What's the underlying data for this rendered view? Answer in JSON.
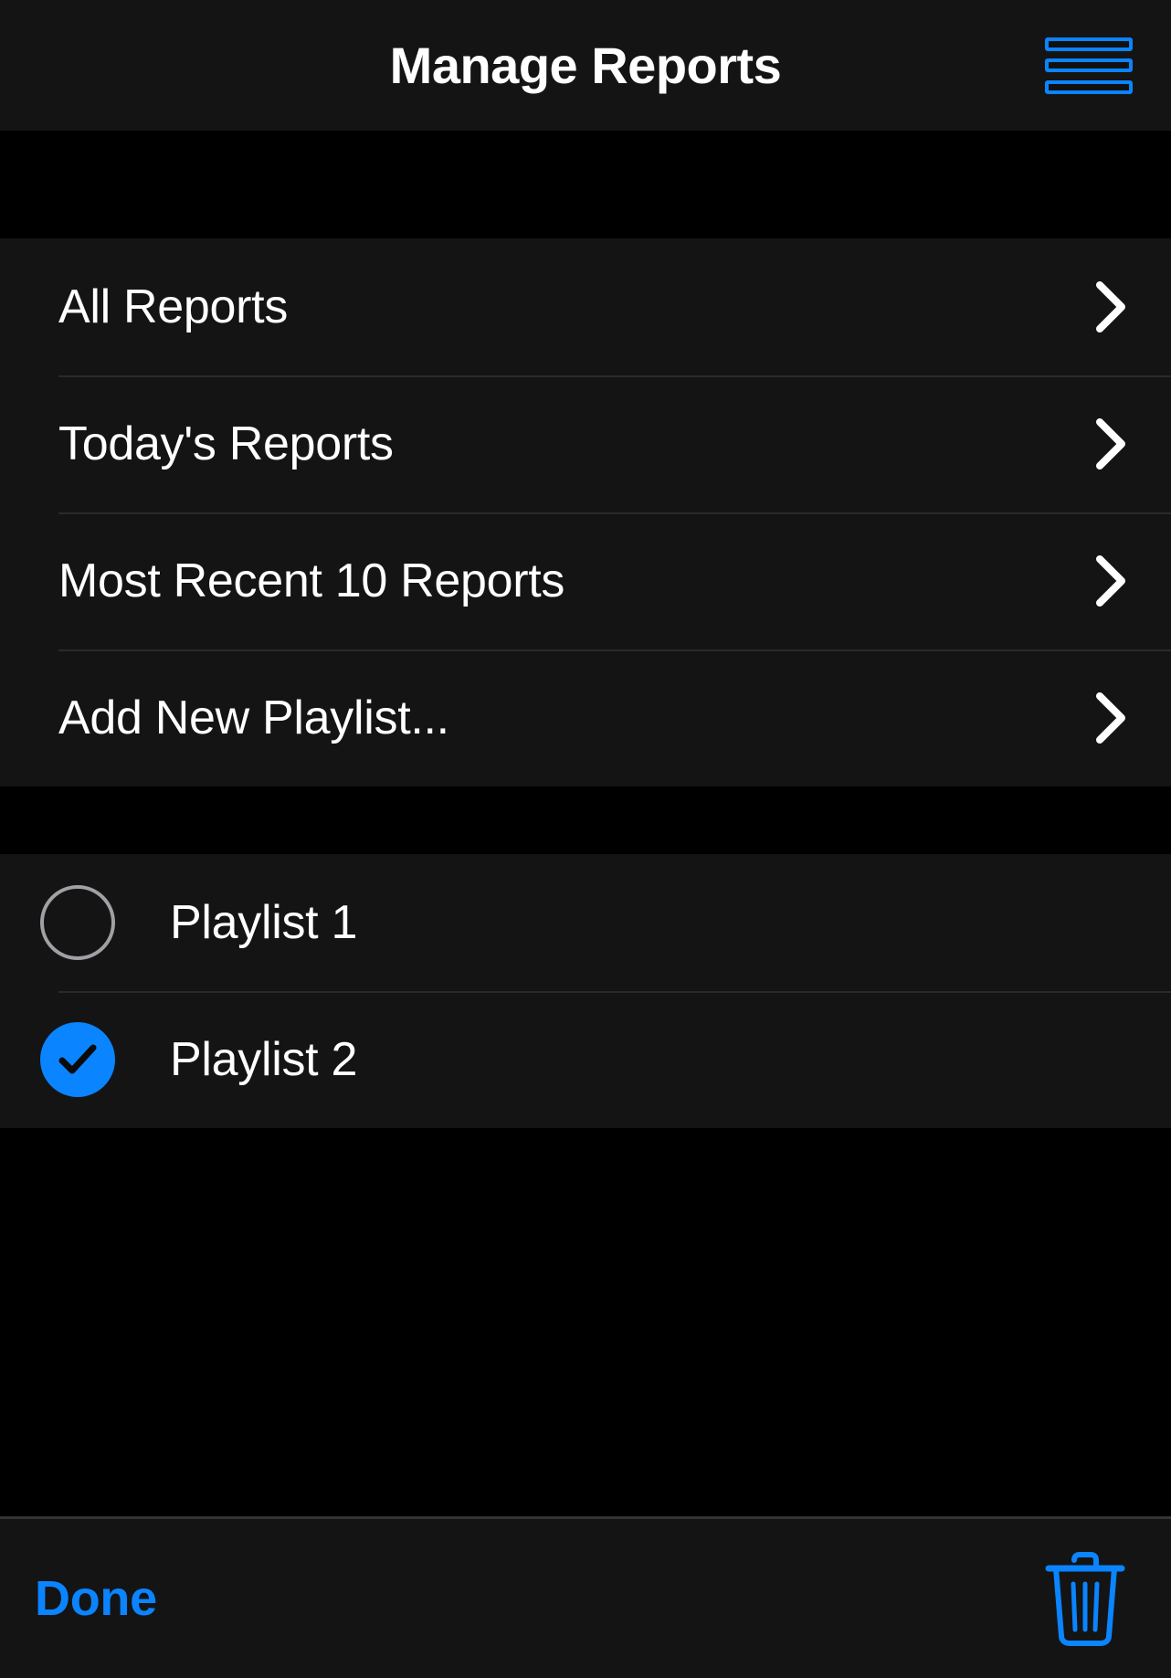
{
  "app": {
    "background_color": "#000000",
    "surface_color": "#141414",
    "accent_color": "#0a84ff",
    "separator_color": "#2a2a2c",
    "text_color": "#ffffff"
  },
  "navbar": {
    "title": "Manage Reports",
    "menu_icon": "hamburger-menu-icon"
  },
  "reports_section": {
    "rows": [
      {
        "label": "All Reports",
        "accessory": "chevron-right-icon"
      },
      {
        "label": "Today's Reports",
        "accessory": "chevron-right-icon"
      },
      {
        "label": "Most Recent 10 Reports",
        "accessory": "chevron-right-icon"
      },
      {
        "label": "Add New Playlist...",
        "accessory": "chevron-right-icon"
      }
    ]
  },
  "playlists_section": {
    "rows": [
      {
        "label": "Playlist 1",
        "checked": false,
        "icon": "circle-outline-icon"
      },
      {
        "label": "Playlist 2",
        "checked": true,
        "icon": "check-circle-filled-icon"
      }
    ]
  },
  "toolbar": {
    "done_label": "Done",
    "delete_icon": "trash-icon"
  }
}
